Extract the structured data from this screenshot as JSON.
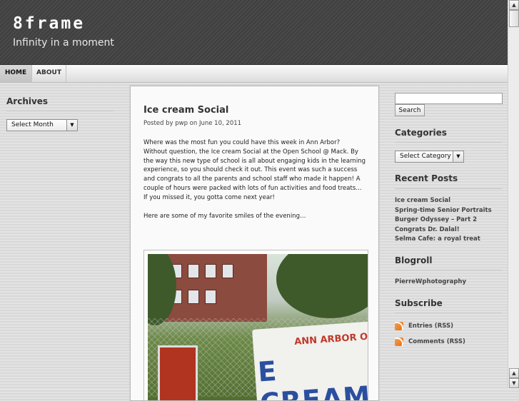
{
  "header": {
    "title": "8frame",
    "tagline": "Infinity in a moment"
  },
  "nav": {
    "items": [
      {
        "label": "HOME"
      },
      {
        "label": "ABOUT"
      }
    ]
  },
  "left": {
    "archives_title": "Archives",
    "archives_select": "Select Month"
  },
  "post": {
    "title": "Ice cream Social",
    "meta": "Posted by pwp on June 10, 2011",
    "paragraphs": [
      "Where was the most fun you could have this week in Ann Arbor? Without question, the Ice cream Social at the Open School @ Mack. By the way this new type of school is all about engaging kids in the learning experience, so you should check it out. This event was such a success and congrats to all the parents and school staff who made it happen! A couple of hours were packed with lots of fun activities and food treats… If you missed it, you gotta come next year!",
      "Here are some of my favorite smiles of the evening…"
    ],
    "photo_banner_top": "ANN ARBOR O",
    "photo_banner_main": "E CREAM"
  },
  "right": {
    "search_button": "Search",
    "categories_title": "Categories",
    "categories_select": "Select Category",
    "recent_title": "Recent Posts",
    "recent": [
      "Ice cream Social",
      "Spring-time Senior Portraits",
      "Burger Odyssey – Part 2",
      "Congrats Dr. Dalal!",
      "Selma Cafe: a royal treat"
    ],
    "blogroll_title": "Blogroll",
    "blogroll": [
      "PierreWphotography"
    ],
    "subscribe_title": "Subscribe",
    "subscribe": [
      "Entries (RSS)",
      "Comments (RSS)"
    ]
  },
  "icons": {
    "rss": "rss-feed-icon",
    "select_arrow": "chevron-down-icon",
    "scroll_up": "arrow-up-icon",
    "scroll_down": "arrow-down-icon"
  }
}
